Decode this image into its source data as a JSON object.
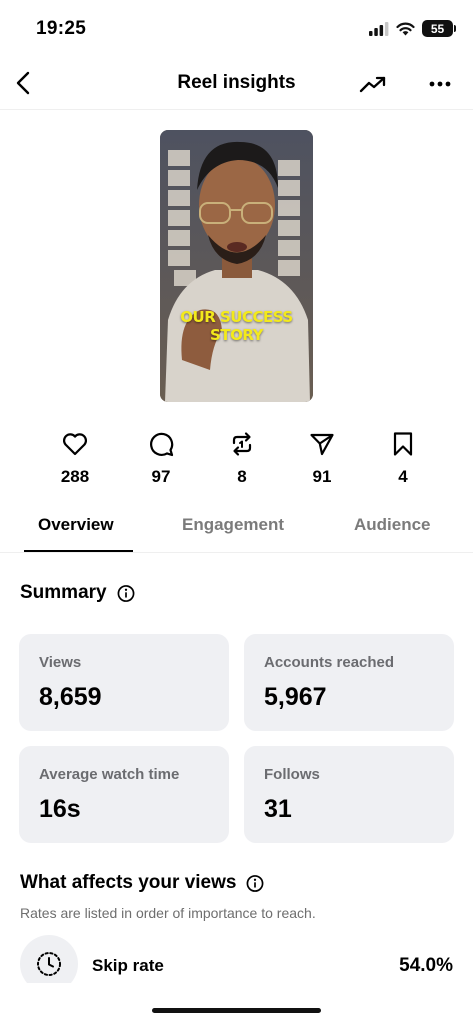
{
  "status_bar": {
    "time": "19:25",
    "battery": "55"
  },
  "nav": {
    "title": "Reel insights",
    "back_icon": "chevron-left-icon",
    "trend_icon": "trending-up-icon",
    "more_icon": "more-horizontal-icon"
  },
  "reel": {
    "overlay_line1": "OUR SUCCESS",
    "overlay_line2": "STORY"
  },
  "stats": {
    "likes": "288",
    "comments": "97",
    "reposts": "8",
    "shares": "91",
    "saves": "4"
  },
  "tabs": [
    {
      "label": "Overview",
      "active": true
    },
    {
      "label": "Engagement",
      "active": false
    },
    {
      "label": "Audience",
      "active": false
    }
  ],
  "summary": {
    "title": "Summary",
    "cards": [
      {
        "label": "Views",
        "value": "8,659"
      },
      {
        "label": "Accounts reached",
        "value": "5,967"
      },
      {
        "label": "Average watch time",
        "value": "16s"
      },
      {
        "label": "Follows",
        "value": "31"
      }
    ]
  },
  "affects": {
    "title": "What affects your views",
    "subtitle": "Rates are listed in order of importance to reach.",
    "metrics": [
      {
        "label": "Skip rate",
        "value": "54.0%",
        "icon": "dotted-clock-icon"
      }
    ]
  }
}
